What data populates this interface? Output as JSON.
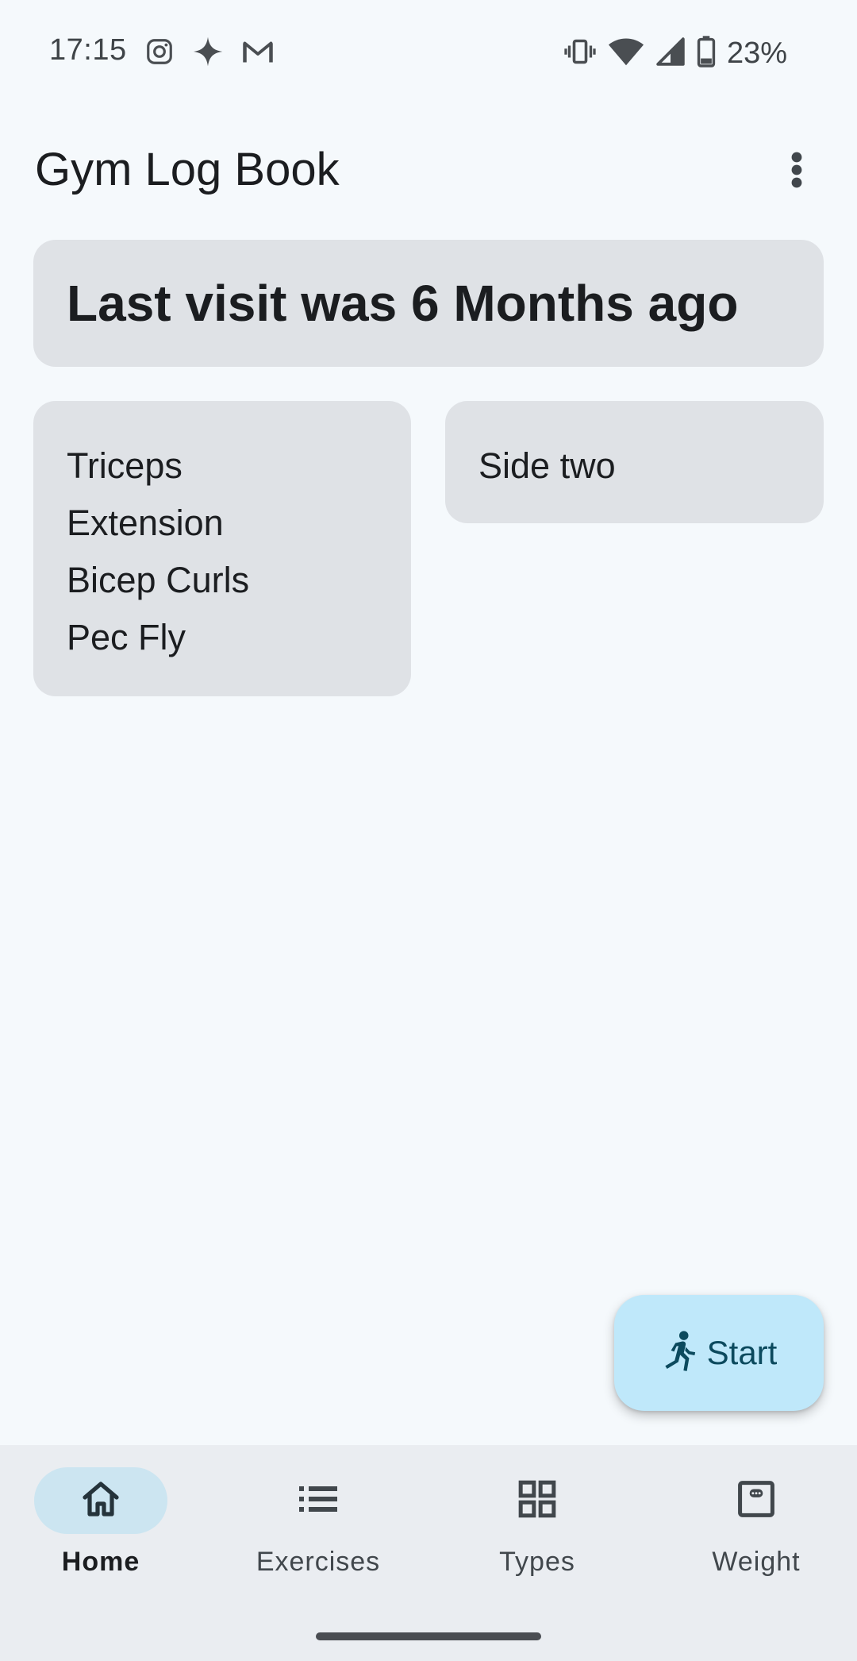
{
  "status_bar": {
    "time": "17:15",
    "battery": "23%",
    "left_icons": [
      "instagram-icon",
      "sparkle-icon",
      "gmail-icon"
    ],
    "right_icons": [
      "vibrate-icon",
      "wifi-icon",
      "signal-icon",
      "battery-icon"
    ]
  },
  "app_bar": {
    "title": "Gym Log Book",
    "menu_icon": "more-vert-icon"
  },
  "last_visit_card": {
    "text": "Last visit was 6 Months ago"
  },
  "side_one": {
    "lines": [
      "Triceps",
      "Extension",
      "Bicep Curls",
      "Pec Fly"
    ]
  },
  "side_two": {
    "label": "Side two"
  },
  "fab": {
    "label": "Start",
    "icon": "directions-run-icon",
    "color": "#bfe8fa"
  },
  "bottom_nav": {
    "items": [
      {
        "label": "Home",
        "icon": "home-icon",
        "active": true
      },
      {
        "label": "Exercises",
        "icon": "list-icon",
        "active": false
      },
      {
        "label": "Types",
        "icon": "grid-icon",
        "active": false
      },
      {
        "label": "Weight",
        "icon": "scale-icon",
        "active": false
      }
    ]
  },
  "colors": {
    "background": "#f5f9fc",
    "card": "#dfe2e6",
    "nav_background": "#eaedf1",
    "active_indicator": "#cce5f1"
  }
}
